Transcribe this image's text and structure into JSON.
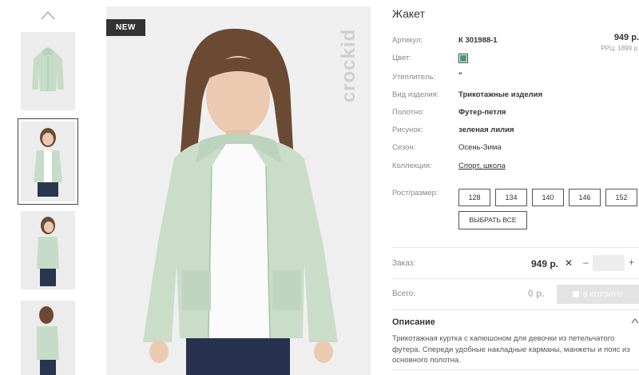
{
  "product": {
    "badge": "NEW",
    "brand_watermark": "crockid",
    "title": "Жакет",
    "price": "949 р.",
    "rrp": "РРЦ: 1899 р."
  },
  "details": [
    {
      "label": "Артикул:",
      "value": "К 301988-1"
    },
    {
      "label": "Цвет:",
      "value": ""
    },
    {
      "label": "Утеплитель:",
      "value": "\""
    },
    {
      "label": "Вид изделия:",
      "value": "Трикотажные изделия"
    },
    {
      "label": "Полотно:",
      "value": "Футер-петля"
    },
    {
      "label": "Рисунок:",
      "value": "зеленая лилия"
    },
    {
      "label": "Сезон:",
      "value": "Осень-Зима"
    },
    {
      "label": "Коллекция:",
      "value": "Спорт, школа"
    }
  ],
  "swatch_color": "#3aa36a",
  "sizes": {
    "label": "Рост/размер:",
    "options": [
      "128",
      "134",
      "140",
      "146",
      "152"
    ],
    "select_all": "ВЫБРАТЬ ВСЕ"
  },
  "order": {
    "label": "Заказ:",
    "price": "949 р.",
    "times": "✕",
    "minus": "–",
    "plus": "+",
    "quantity": ""
  },
  "total": {
    "label": "Всего:",
    "value": "0 р.",
    "cart_button": "В КОРЗИНУ"
  },
  "description": {
    "title": "Описание",
    "text": "Трикотажная куртка с капюшоном для девочки из петельчатого футера. Спереди удобные накладные карманы, манжеты и пояс из основного полотна."
  },
  "icons": {
    "thumb_scroll_up": "chevron-up-icon",
    "description_toggle": "chevron-up-icon",
    "cart": "shopping-bag-icon"
  }
}
